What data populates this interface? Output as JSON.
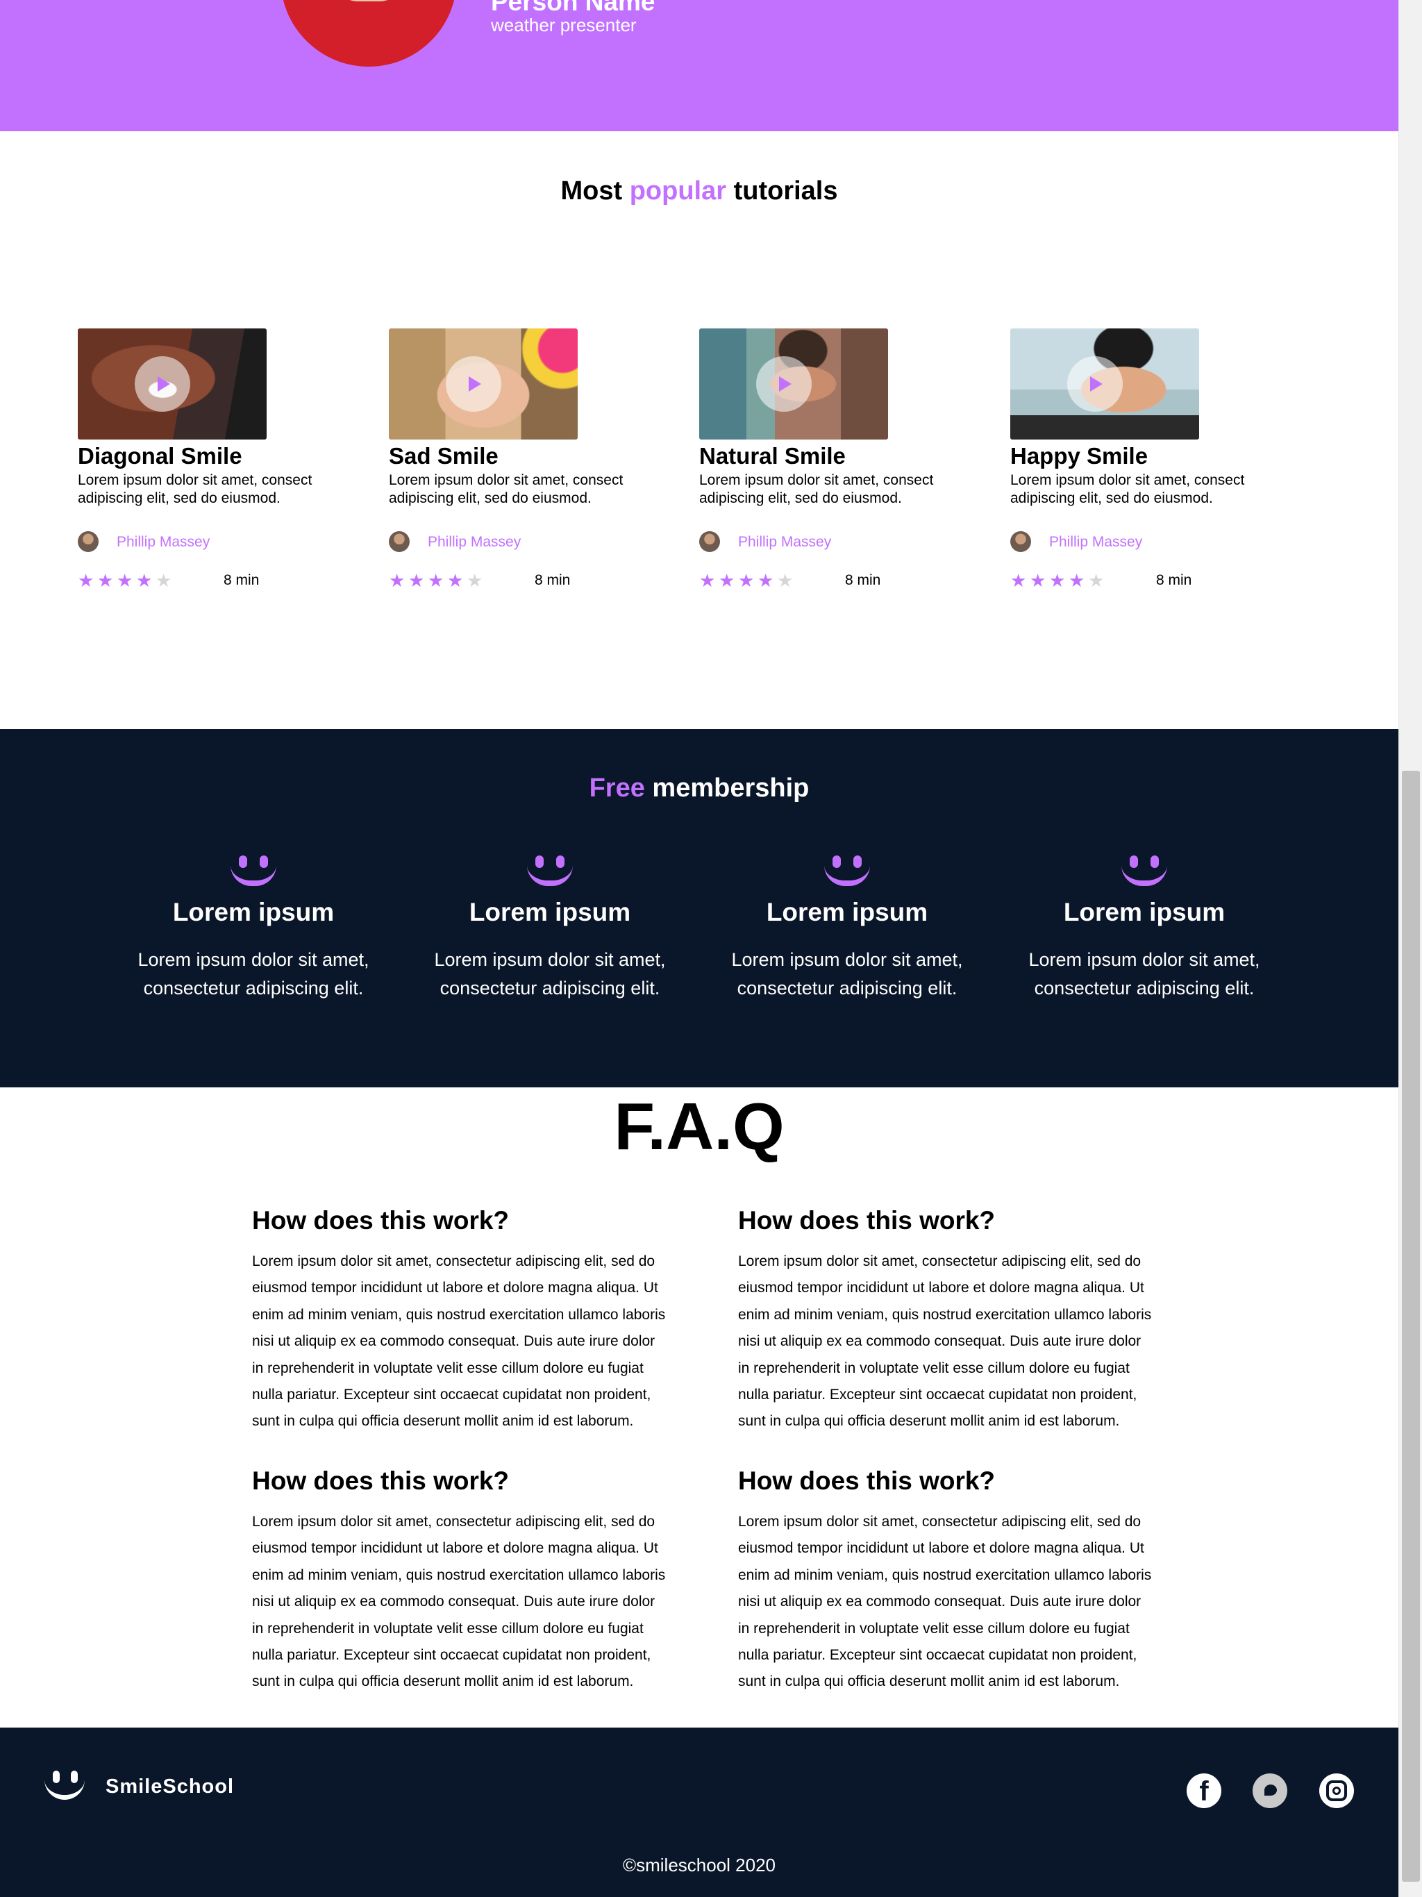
{
  "hero": {
    "person_name": "Person Name",
    "person_role": "weather presenter"
  },
  "popular": {
    "title_before": "Most ",
    "title_highlight": "popular",
    "title_after": " tutorials",
    "cards": [
      {
        "title": "Diagonal Smile",
        "description": "Lorem ipsum dolor sit amet, consect adipiscing elit, sed do eiusmod.",
        "author": "Phillip Massey",
        "rating": 4,
        "rating_max": 5,
        "duration": "8 min"
      },
      {
        "title": "Sad Smile",
        "description": "Lorem ipsum dolor sit amet, consect adipiscing elit, sed do eiusmod.",
        "author": "Phillip Massey",
        "rating": 4,
        "rating_max": 5,
        "duration": "8 min"
      },
      {
        "title": "Natural Smile",
        "description": "Lorem ipsum dolor sit amet, consect adipiscing elit, sed do eiusmod.",
        "author": "Phillip Massey",
        "rating": 4,
        "rating_max": 5,
        "duration": "8 min"
      },
      {
        "title": "Happy Smile",
        "description": "Lorem ipsum dolor sit amet, consect adipiscing elit, sed do eiusmod.",
        "author": "Phillip Massey",
        "rating": 4,
        "rating_max": 5,
        "duration": "8 min"
      }
    ]
  },
  "membership": {
    "title_highlight": "Free",
    "title_after": " membership",
    "features": [
      {
        "title": "Lorem ipsum",
        "description": "Lorem ipsum dolor sit amet, consectetur adipiscing elit."
      },
      {
        "title": "Lorem ipsum",
        "description": "Lorem ipsum dolor sit amet, consectetur adipiscing elit."
      },
      {
        "title": "Lorem ipsum",
        "description": "Lorem ipsum dolor sit amet, consectetur adipiscing elit."
      },
      {
        "title": "Lorem ipsum",
        "description": "Lorem ipsum dolor sit amet, consectetur adipiscing elit."
      }
    ]
  },
  "faq": {
    "title": "F.A.Q",
    "items": [
      {
        "question": "How does this work?",
        "answer": "Lorem ipsum dolor sit amet, consectetur adipiscing elit, sed do eiusmod tempor incididunt ut labore et dolore magna aliqua. Ut enim ad minim veniam, quis nostrud exercitation ullamco laboris nisi ut aliquip ex ea commodo consequat. Duis aute irure dolor in reprehenderit in voluptate velit esse cillum dolore eu fugiat nulla pariatur. Excepteur sint occaecat cupidatat non proident, sunt in culpa qui officia deserunt mollit anim id est laborum."
      },
      {
        "question": "How does this work?",
        "answer": "Lorem ipsum dolor sit amet, consectetur adipiscing elit, sed do eiusmod tempor incididunt ut labore et dolore magna aliqua. Ut enim ad minim veniam, quis nostrud exercitation ullamco laboris nisi ut aliquip ex ea commodo consequat. Duis aute irure dolor in reprehenderit in voluptate velit esse cillum dolore eu fugiat nulla pariatur. Excepteur sint occaecat cupidatat non proident, sunt in culpa qui officia deserunt mollit anim id est laborum."
      },
      {
        "question": "How does this work?",
        "answer": "Lorem ipsum dolor sit amet, consectetur adipiscing elit, sed do eiusmod tempor incididunt ut labore et dolore magna aliqua. Ut enim ad minim veniam, quis nostrud exercitation ullamco laboris nisi ut aliquip ex ea commodo consequat. Duis aute irure dolor in reprehenderit in voluptate velit esse cillum dolore eu fugiat nulla pariatur. Excepteur sint occaecat cupidatat non proident, sunt in culpa qui officia deserunt mollit anim id est laborum."
      },
      {
        "question": "How does this work?",
        "answer": "Lorem ipsum dolor sit amet, consectetur adipiscing elit, sed do eiusmod tempor incididunt ut labore et dolore magna aliqua. Ut enim ad minim veniam, quis nostrud exercitation ullamco laboris nisi ut aliquip ex ea commodo consequat. Duis aute irure dolor in reprehenderit in voluptate velit esse cillum dolore eu fugiat nulla pariatur. Excepteur sint occaecat cupidatat non proident, sunt in culpa qui officia deserunt mollit anim id est laborum."
      }
    ]
  },
  "footer": {
    "brand": "SmileSchool",
    "copyright": "©smileschool 2020",
    "social_icons": [
      "facebook-icon",
      "twitter-icon",
      "instagram-icon"
    ]
  },
  "colors": {
    "accent": "#c271ff",
    "dark": "#0a1629"
  }
}
